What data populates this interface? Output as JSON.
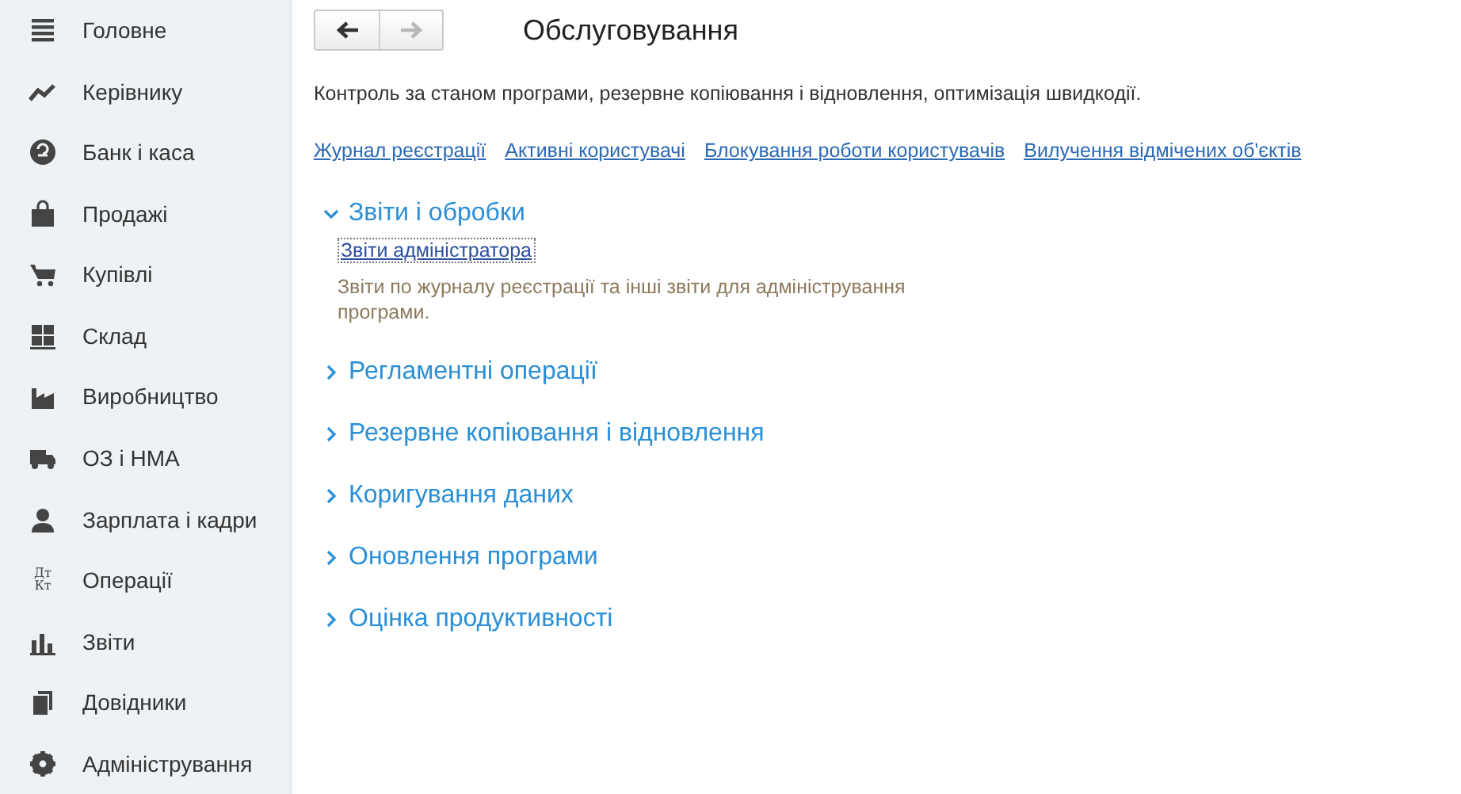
{
  "sidebar": {
    "items": [
      {
        "label": "Головне"
      },
      {
        "label": "Керівнику"
      },
      {
        "label": "Банк і каса"
      },
      {
        "label": "Продажі"
      },
      {
        "label": "Купівлі"
      },
      {
        "label": "Склад"
      },
      {
        "label": "Виробництво"
      },
      {
        "label": "ОЗ і НМА"
      },
      {
        "label": "Зарплата і кадри"
      },
      {
        "label": "Операції",
        "icon_text": [
          "Дт",
          "Кт"
        ]
      },
      {
        "label": "Звіти"
      },
      {
        "label": "Довідники"
      },
      {
        "label": "Адміністрування"
      }
    ]
  },
  "nav": {
    "back": {
      "disabled": false
    },
    "forward": {
      "disabled": true
    }
  },
  "title": "Обслуговування",
  "description": "Контроль за станом програми, резервне копіювання і відновлення, оптимізація швидкодії.",
  "links": [
    "Журнал реєстрації",
    "Активні користувачі",
    "Блокування роботи користувачів",
    "Вилучення відмічених об'єктів"
  ],
  "sections": [
    {
      "title": "Звіти і обробки",
      "expanded": true,
      "items": [
        {
          "link": "Звіти адміністратора",
          "focused": true,
          "description": "Звіти по журналу реєстрації та інші звіти для адміністрування програми."
        }
      ]
    },
    {
      "title": "Регламентні операції",
      "expanded": false
    },
    {
      "title": "Резервне копіювання і відновлення",
      "expanded": false
    },
    {
      "title": "Коригування даних",
      "expanded": false
    },
    {
      "title": "Оновлення програми",
      "expanded": false
    },
    {
      "title": "Оцінка продуктивності",
      "expanded": false
    }
  ]
}
